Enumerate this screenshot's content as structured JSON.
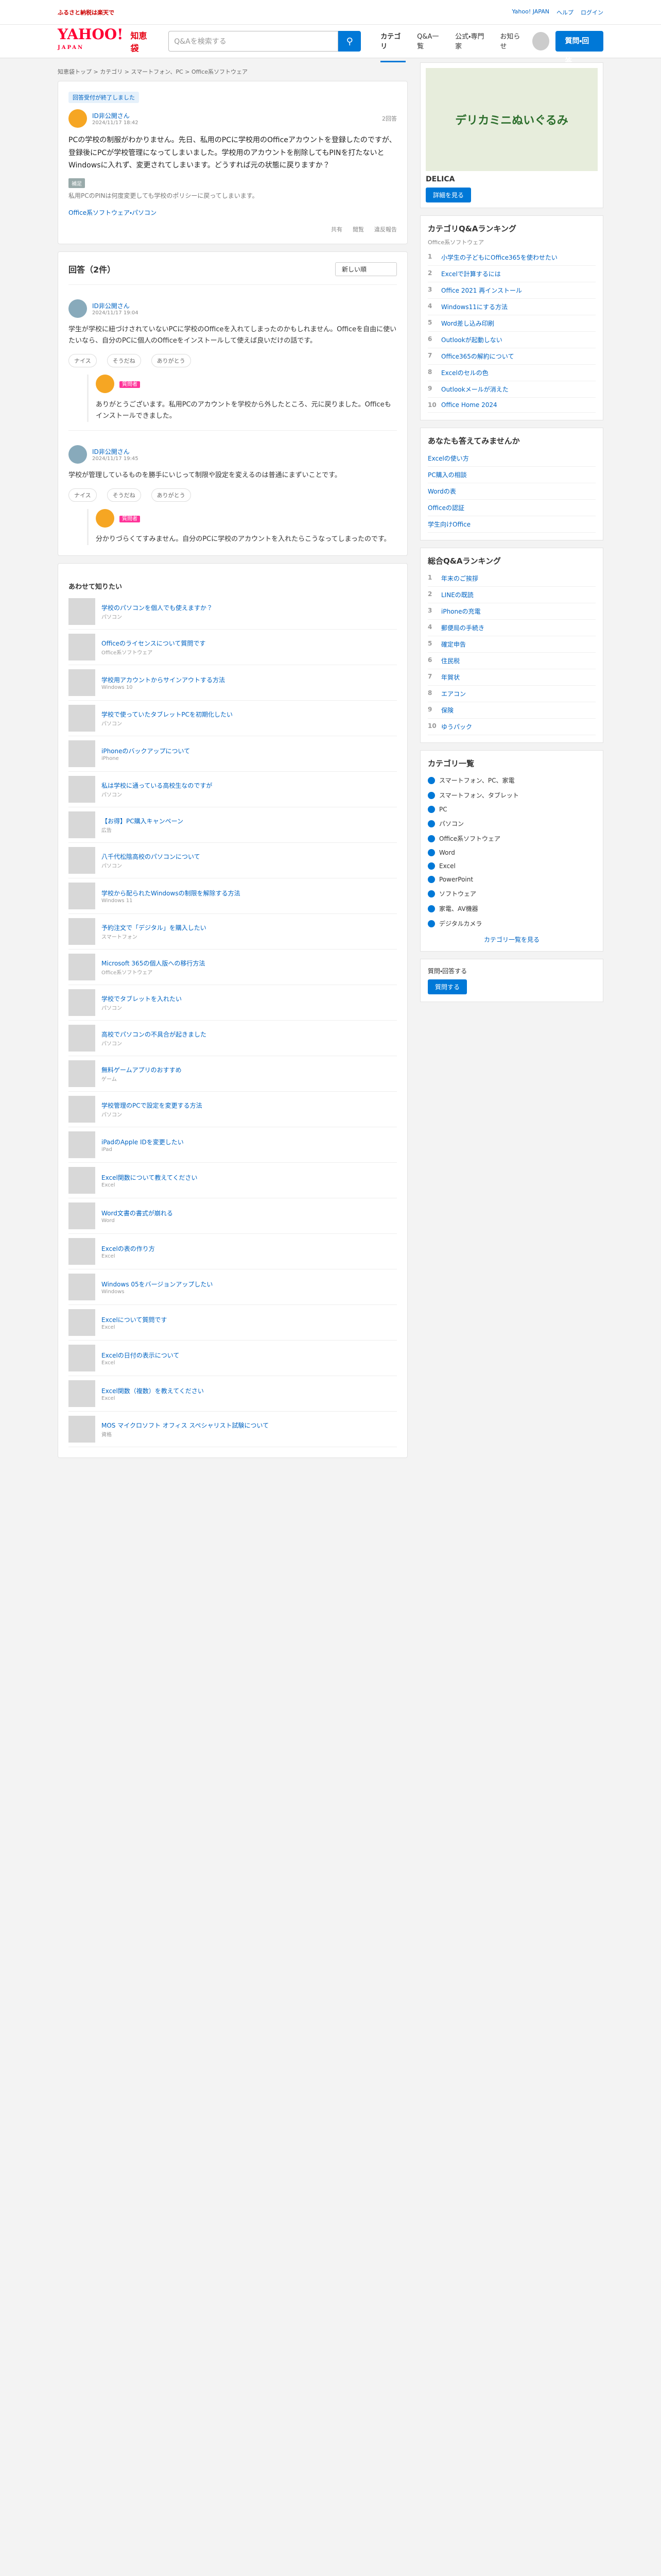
{
  "topbar": {
    "promo": "ふるさと納税は楽天で",
    "links": [
      "Yahoo! JAPAN",
      "ヘルプ",
      "ログイン"
    ]
  },
  "header": {
    "logo": "YAHOO!",
    "logo_sub": "JAPAN",
    "service": "知恵袋",
    "search_placeholder": "Q&Aを検索する",
    "nav": [
      "カテゴリ",
      "Q&A一覧",
      "公式・専門家",
      "お知らせ"
    ],
    "ask_label": "質問・回答"
  },
  "breadcrumb": "知恵袋トップ > カテゴリ > スマートフォン、PC > Office系ソフトウェア",
  "question": {
    "badge": "回答受付が終了しました",
    "user": "ID非公開さん",
    "date": "2024/11/17 18:42",
    "views": "2回答",
    "body": "PCの学校の制服がわかりません。先日、私用のPCに学校用のOfficeアカウントを登録したのですが、登録後にPCが学校管理になってしまいました。学校用のアカウントを削除してもPINを打たないとWindowsに入れず、変更されてしまいます。どうすれば元の状態に戻りますか？",
    "supp_label": "補足",
    "supp": "私用PCのPINは何度変更しても学校のポリシーに戻ってしまいます。",
    "tags": "Office系ソフトウェア・パソコン",
    "actions": [
      "共有",
      "閲覧",
      "違反報告"
    ]
  },
  "answers": {
    "title": "回答（2件）",
    "sort": "新しい順",
    "items": [
      {
        "user": "ID非公開さん",
        "date": "2024/11/17 19:04",
        "body": "学生が学校に紐づけされていないPCに学校のOfficeを入れてしまったのかもしれません。Officeを自由に使いたいなら、自分のPCに個人のOfficeをインストールして使えば良いだけの話です。",
        "reacts": [
          "ナイス",
          "そうだね",
          "ありがとう"
        ],
        "reply_user": "質問者",
        "reply_tag": "質問者",
        "reply": "ありがとうございます。私用PCのアカウントを学校から外したところ、元に戻りました。Officeもインストールできました。"
      },
      {
        "user": "ID非公開さん",
        "date": "2024/11/17 19:45",
        "body": "学校が管理しているものを勝手にいじって制限や設定を変えるのは普通にまずいことです。",
        "reacts": [
          "ナイス",
          "そうだね",
          "ありがとう"
        ],
        "reply_user": "質問者",
        "reply_tag": "質問者",
        "reply": "分かりづらくてすみません。自分のPCに学校のアカウントを入れたらこうなってしまったのです。"
      }
    ]
  },
  "related": {
    "title": "あわせて知りたい",
    "items": [
      {
        "t": "学校のパソコンを個人でも使えますか？",
        "s": "パソコン"
      },
      {
        "t": "Officeのライセンスについて質問です",
        "s": "Office系ソフトウェア"
      },
      {
        "t": "学校用アカウントからサインアウトする方法",
        "s": "Windows 10"
      },
      {
        "t": "学校で使っていたタブレットPCを初期化したい",
        "s": "パソコン"
      },
      {
        "t": "iPhoneのバックアップについて",
        "s": "iPhone"
      },
      {
        "t": "私は学校に通っている高校生なのですが",
        "s": "パソコン"
      },
      {
        "t": "【お得】PC購入キャンペーン",
        "s": "広告"
      },
      {
        "t": "八千代松陰高校のパソコンについて",
        "s": "パソコン"
      },
      {
        "t": "学校から配られたWindowsの制限を解除する方法",
        "s": "Windows 11"
      },
      {
        "t": "予約注文で「デジタル」を購入したい",
        "s": "スマートフォン"
      },
      {
        "t": "Microsoft 365の個人版への移行方法",
        "s": "Office系ソフトウェア"
      },
      {
        "t": "学校でタブレットを入れたい",
        "s": "パソコン"
      },
      {
        "t": "高校でパソコンの不具合が起きました",
        "s": "パソコン"
      },
      {
        "t": "無料ゲームアプリのおすすめ",
        "s": "ゲーム"
      },
      {
        "t": "学校管理のPCで設定を変更する方法",
        "s": "パソコン"
      },
      {
        "t": "iPadのApple IDを変更したい",
        "s": "iPad"
      },
      {
        "t": "Excel関数について教えてください",
        "s": "Excel"
      },
      {
        "t": "Word文書の書式が崩れる",
        "s": "Word"
      },
      {
        "t": "Excelの表の作り方",
        "s": "Excel"
      },
      {
        "t": "Windows 05をバージョンアップしたい",
        "s": "Windows"
      },
      {
        "t": "Excelについて質問です",
        "s": "Excel"
      },
      {
        "t": "Excelの日付の表示について",
        "s": "Excel"
      },
      {
        "t": "Excel関数（複数）を教えてください",
        "s": "Excel"
      },
      {
        "t": "MOS マイクロソフト オフィス スペシャリスト試験について",
        "s": "資格"
      }
    ]
  },
  "ad": {
    "title": "デリカミニぬいぐるみ",
    "sub": "DELICA",
    "btn": "詳細を見る"
  },
  "side": {
    "rank_title": "カテゴリQ&Aランキング",
    "rank_sub": "Office系ソフトウェア",
    "ranks": [
      "小学生の子どもにOffice365を使わせたい",
      "Excelで計算するには",
      "Office 2021 再インストール",
      "Windows11にする方法",
      "Word差し込み印刷",
      "Outlookが起動しない",
      "Office365の解約について",
      "Excelのセルの色",
      "Outlookメールが消えた",
      "Office Home 2024"
    ],
    "others_title": "あなたも答えてみませんか",
    "others": [
      "Excelの使い方",
      "PC購入の相談",
      "Wordの表",
      "Officeの認証",
      "学生向けOffice"
    ],
    "overall_title": "総合Q&Aランキング",
    "overall": [
      "年末のご挨拶",
      "LINEの既読",
      "iPhoneの充電",
      "郵便局の手続き",
      "確定申告",
      "住民税",
      "年賀状",
      "エアコン",
      "保険",
      "ゆうパック"
    ],
    "cat_title": "カテゴリ一覧",
    "cats": [
      "スマートフォン、PC、家電",
      "スマートフォン、タブレット",
      "PC",
      "パソコン",
      "Office系ソフトウェア",
      "Word",
      "Excel",
      "PowerPoint",
      "ソフトウェア",
      "家電、AV機器",
      "デジタルカメラ"
    ],
    "more": "カテゴリ一覧を見る",
    "promo_title": "質問・回答する",
    "promo_btn": "質問する"
  }
}
